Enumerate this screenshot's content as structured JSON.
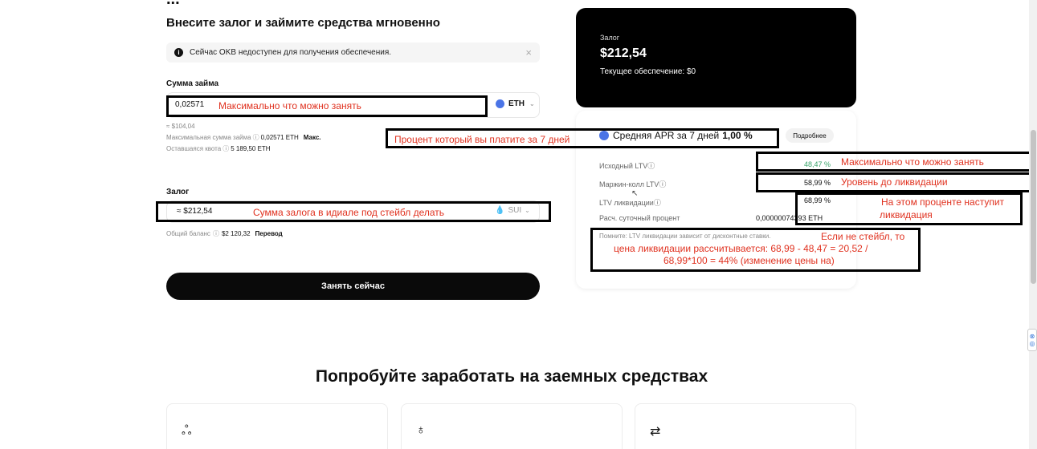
{
  "header": {
    "title_cut": "...",
    "subtitle": "Внесите залог и займите средства мгновенно"
  },
  "notice": {
    "text": "Сейчас OKB недоступен для получения обеспечения.",
    "close": "×"
  },
  "loan": {
    "label": "Сумма займа",
    "value": "0,02571",
    "token": "ETH",
    "usd": "≈ $104,04",
    "max_label": "Максимальная сумма займа",
    "max_value": "0,02571 ETH",
    "max_link": "Макс.",
    "quota_label": "Оставшаяся квота",
    "quota_value": "5 189,50 ETH"
  },
  "collateral": {
    "label": "Залог",
    "value": "≈ $212,54",
    "token": "SUI",
    "balance_label": "Общий баланс",
    "balance_value": "$2 120,32",
    "transfer": "Перевод"
  },
  "cta": "Занять сейчас",
  "summary": {
    "label": "Залог",
    "value": "$212,54",
    "current": "Текущее обеспечение: $0"
  },
  "apr": {
    "label": "Средняя APR за 7 дней",
    "value": "1,00 %",
    "more": "Подробнее"
  },
  "rows": [
    {
      "label": "Исходный LTV",
      "value": "48,47 %"
    },
    {
      "label": "Маржин-колл LTV",
      "value": "58,99 %"
    },
    {
      "label": "LTV ликвидации",
      "value": "68,99 %"
    },
    {
      "label": "Расч. суточный процент",
      "value": "0,0000007",
      "value_tail": "4393 ETH"
    }
  ],
  "reminder": "Помните: LTV ликвидации зависит от дисконтные ставки.",
  "annotations": {
    "max_borrow": "Максимально что можно занять",
    "apr_note": "Процент который вы платите за 7 дней",
    "collateral_note": "Сумма залога в идиале под стейбл делать",
    "ltv_max": "Максимально что можно занять",
    "margin_level": "Уровень до ликвидации",
    "liquidation_1": "На этом проценте наступит",
    "liquidation_2": "ликвидация",
    "formula_1": "Если не стейбл, то",
    "formula_2": "цена ликвидации рассчитывается: 68,99 - 48,47 = 20,52 /",
    "formula_3": "68,99*100 = 44% (изменение цены на)"
  },
  "section": {
    "title": "Попробуйте заработать на заемных средствах"
  },
  "icons": {
    "info": "info-icon",
    "coin_eth": "eth-coin-icon",
    "coin_sui": "sui-drop-icon",
    "chevron": "chevron-down-icon",
    "feature_1": "network-icon",
    "feature_2": "money-bag-icon",
    "feature_3": "swap-icon"
  },
  "colors": {
    "accent": "#000000",
    "annotation": "#e0311f",
    "eth": "#4a74e6",
    "ltv_green": "#3aa56b"
  }
}
